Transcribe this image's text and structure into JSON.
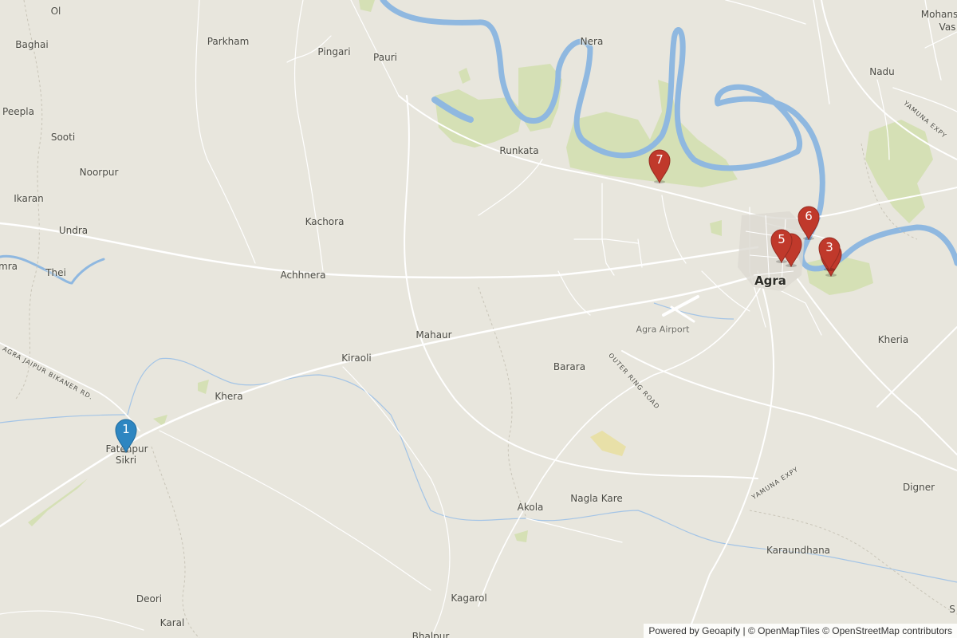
{
  "colors": {
    "land": "#e8e6dd",
    "water": "#8fb8e0",
    "park": "#d5e0b5",
    "road": "#ffffff",
    "marker_blue": "#2e86c1",
    "marker_red": "#c0392b"
  },
  "places": {
    "ol": "Ol",
    "mohans": "Mohans",
    "vas": "Vas",
    "baghai": "Baghai",
    "parkham": "Parkham",
    "pingari": "Pingari",
    "pauri": "Pauri",
    "nera": "Nera",
    "nadu": "Nadu",
    "peepla": "Peepla",
    "sooti": "Sooti",
    "runkata": "Runkata",
    "noorpur": "Noorpur",
    "ikaran": "Ikaran",
    "kachora": "Kachora",
    "undra": "Undra",
    "mra": "mra",
    "thei": "Thei",
    "achhnera": "Achhnera",
    "agra": "Agra",
    "mahaur": "Mahaur",
    "agra_airport": "Agra Airport",
    "kheria": "Kheria",
    "kiraoli": "Kiraoli",
    "barara": "Barara",
    "khera": "Khera",
    "fatehpur": "Fatehpur",
    "sikri": "Sikri",
    "digner": "Digner",
    "akola": "Akola",
    "nagla_kare": "Nagla Kare",
    "karaundhana": "Karaundhana",
    "deori": "Deori",
    "kagarol": "Kagarol",
    "karal": "Karal",
    "bhalpur": "Bhalpur",
    "s": "S"
  },
  "roads": {
    "agra_jaipur": "AGRA JAIPUR BIKANER RD.",
    "outer_ring": "OUTER RING ROAD",
    "yamuna_expy_1": "YAMUNA EXPY",
    "yamuna_expy_2": "YAMUNA EXPY"
  },
  "markers": [
    {
      "label": "1",
      "color": "blue",
      "place": "Fatehpur Sikri"
    },
    {
      "label": "7",
      "color": "red"
    },
    {
      "label": "6",
      "color": "red"
    },
    {
      "label": "5",
      "color": "red"
    },
    {
      "label": "",
      "color": "red"
    },
    {
      "label": "",
      "color": "red"
    },
    {
      "label": "3",
      "color": "red"
    }
  ],
  "attribution": {
    "powered": "Powered by",
    "geoapify": "Geoapify",
    "sep": " | ",
    "omt": "© OpenMapTiles",
    "osm": "© OpenStreetMap",
    "contributors": " contributors"
  }
}
